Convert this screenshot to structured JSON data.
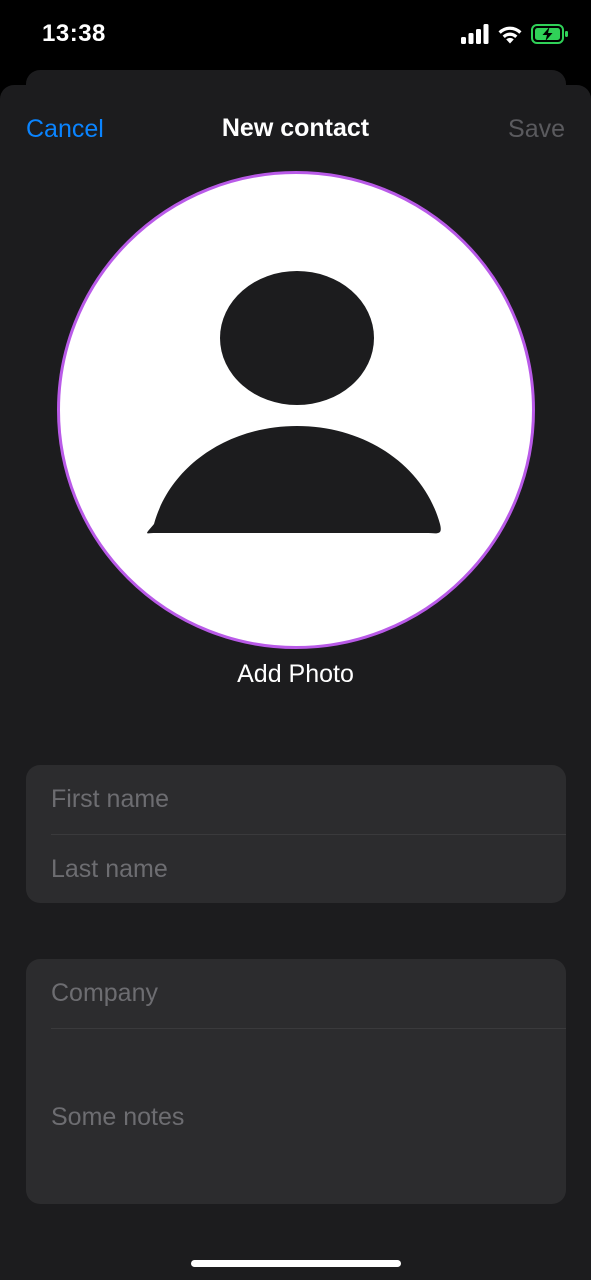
{
  "status_bar": {
    "time": "13:38",
    "icons": [
      "cellular-signal-icon",
      "wifi-icon",
      "battery-charging-icon"
    ],
    "battery_color": "#30d158"
  },
  "nav": {
    "cancel_label": "Cancel",
    "title": "New contact",
    "save_label": "Save"
  },
  "avatar": {
    "icon": "person-silhouette-icon",
    "ring_color": "#b95ae8",
    "add_photo_label": "Add Photo"
  },
  "form": {
    "first_name": {
      "value": "",
      "placeholder": "First name"
    },
    "last_name": {
      "value": "",
      "placeholder": "Last name"
    },
    "company": {
      "value": "",
      "placeholder": "Company"
    },
    "notes": {
      "value": "",
      "placeholder": "Some notes"
    }
  },
  "colors": {
    "accent": "#0a84ff",
    "sheet_background": "#1c1c1e",
    "field_background": "#2c2c2e",
    "disabled_text": "#5a5a5e"
  }
}
